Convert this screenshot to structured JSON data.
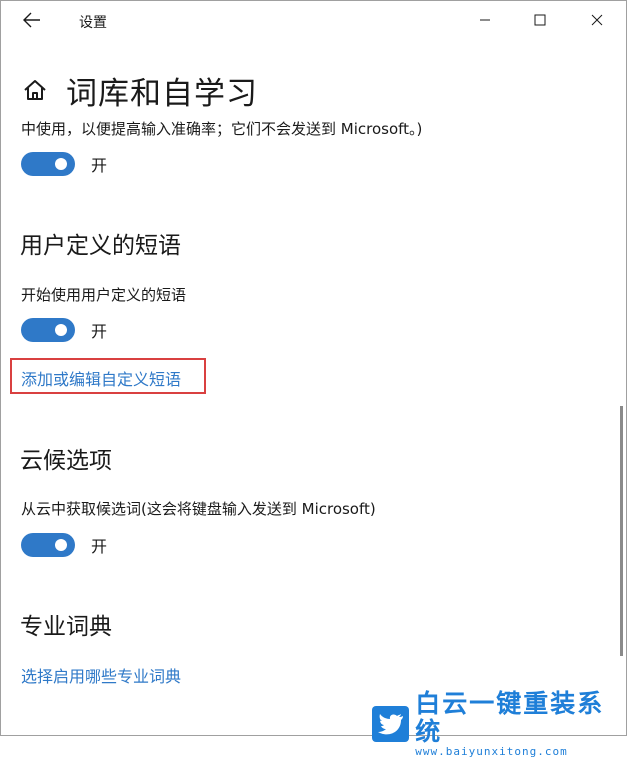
{
  "window": {
    "title": "设置"
  },
  "icons": {
    "back": "back-arrow-icon",
    "minimize": "minimize-icon",
    "maximize": "maximize-icon",
    "close": "close-icon",
    "home": "home-icon",
    "watermark": "bird-icon"
  },
  "page": {
    "title": "词库和自学习",
    "description_tail": "中使用，以便提高输入准确率；它们不会发送到 Microsoft。)",
    "top_toggle_state": "开"
  },
  "sections": {
    "custom_phrases": {
      "heading": "用户定义的短语",
      "setting_label": "开始使用用户定义的短语",
      "toggle_state": "开",
      "link": "添加或编辑自定义短语"
    },
    "cloud": {
      "heading": "云候选项",
      "setting_label": "从云中获取候选词(这会将键盘输入发送到 Microsoft)",
      "toggle_state": "开"
    },
    "dictionary": {
      "heading": "专业词典",
      "link": "选择启用哪些专业词典"
    }
  },
  "watermark": {
    "name": "白云一键重装系统",
    "url": "www.baiyunxitong.com"
  },
  "colors": {
    "accent": "#2f79c8",
    "highlight_box": "#d94040",
    "watermark": "#1f7fd8"
  }
}
